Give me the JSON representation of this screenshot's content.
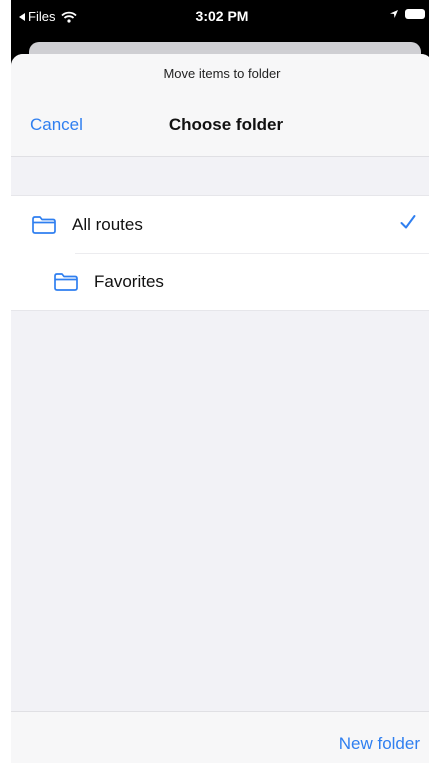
{
  "status_bar": {
    "back_app": "Files",
    "time": "3:02 PM"
  },
  "sheet": {
    "subtitle": "Move items to folder",
    "cancel_label": "Cancel",
    "title": "Choose folder"
  },
  "folders": [
    {
      "label": "All routes",
      "icon": "folder-icon",
      "selected": true
    },
    {
      "label": "Favorites",
      "icon": "folder-icon",
      "selected": false
    }
  ],
  "footer": {
    "new_folder_label": "New folder"
  },
  "colors": {
    "accent": "#2f7ff0",
    "sheet_background": "#f2f2f6"
  }
}
